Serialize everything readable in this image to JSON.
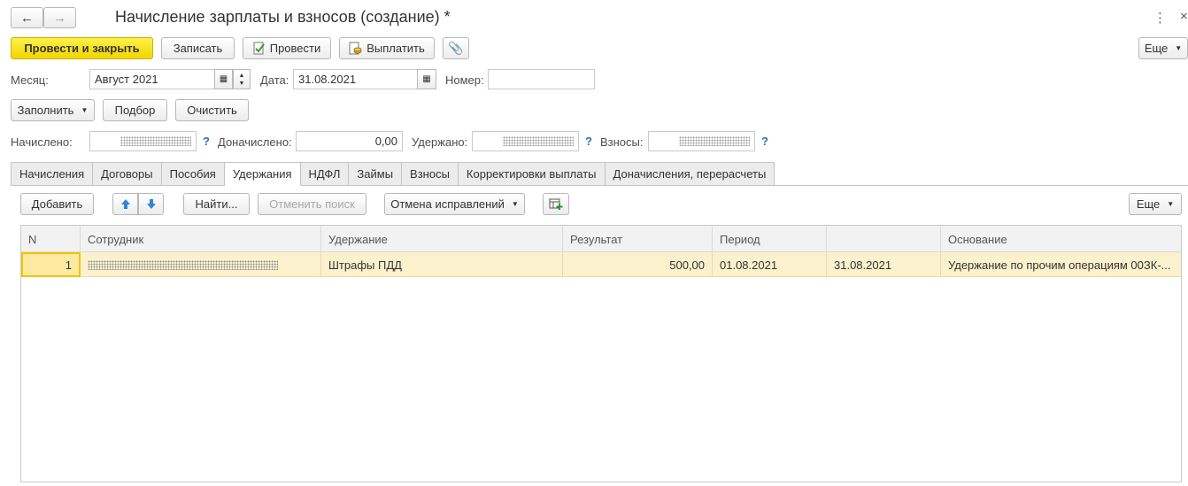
{
  "window": {
    "title": "Начисление зарплаты и взносов (создание) *",
    "more_menu_icon": "kebab-menu-icon",
    "close_icon": "close-icon"
  },
  "toolbar": {
    "post_and_close": "Провести и закрыть",
    "save": "Записать",
    "post": "Провести",
    "pay": "Выплатить",
    "more": "Еще"
  },
  "header": {
    "month_label": "Месяц:",
    "month_value": "Август 2021",
    "date_label": "Дата:",
    "date_value": "31.08.2021",
    "number_label": "Номер:",
    "number_value": ""
  },
  "actions": {
    "fill": "Заполнить",
    "select": "Подбор",
    "clear": "Очистить"
  },
  "totals": {
    "accrued_label": "Начислено:",
    "additional_label": "Доначислено:",
    "additional_value": "0,00",
    "withheld_label": "Удержано:",
    "contributions_label": "Взносы:",
    "help_mark": "?"
  },
  "tabs": [
    {
      "label": "Начисления",
      "active": false
    },
    {
      "label": "Договоры",
      "active": false
    },
    {
      "label": "Пособия",
      "active": false
    },
    {
      "label": "Удержания",
      "active": true
    },
    {
      "label": "НДФЛ",
      "active": false
    },
    {
      "label": "Займы",
      "active": false
    },
    {
      "label": "Взносы",
      "active": false
    },
    {
      "label": "Корректировки выплаты",
      "active": false
    },
    {
      "label": "Доначисления, перерасчеты",
      "active": false
    }
  ],
  "table_toolbar": {
    "add": "Добавить",
    "find": "Найти...",
    "cancel_search": "Отменить поиск",
    "cancel_corrections": "Отмена исправлений",
    "more": "Еще"
  },
  "table": {
    "columns": [
      "N",
      "Сотрудник",
      "Удержание",
      "Результат",
      "Период",
      "",
      "Основание"
    ],
    "rows": [
      {
        "n": "1",
        "employee": "",
        "deduction": "Штрафы ПДД",
        "result": "500,00",
        "period_start": "01.08.2021",
        "period_end": "31.08.2021",
        "basis": "Удержание по прочим операциям 00ЗК-..."
      }
    ]
  },
  "colors": {
    "primary_button": "#f2d500",
    "selected_row": "#fbf1cc",
    "help_mark": "#2c6fb4"
  }
}
